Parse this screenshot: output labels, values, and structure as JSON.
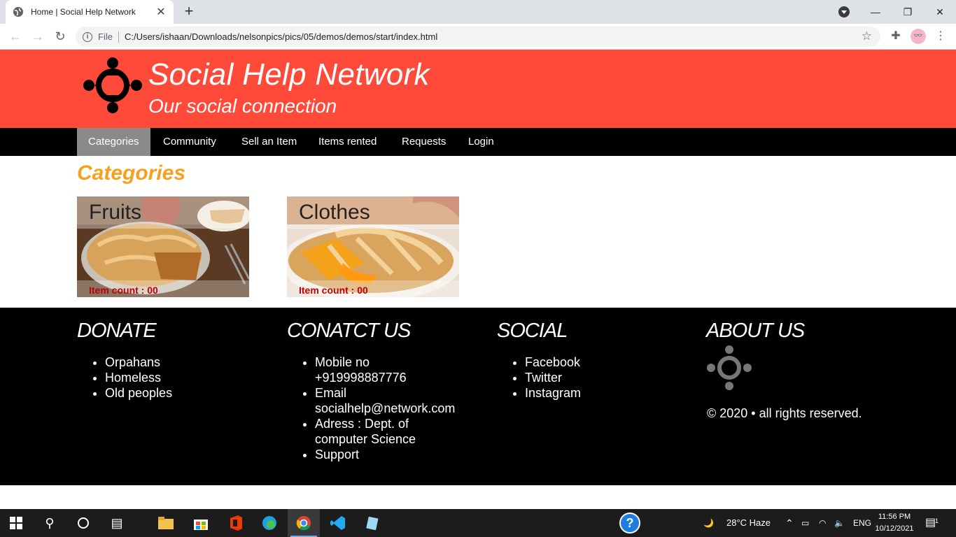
{
  "browser": {
    "tab_title": "Home | Social Help Network",
    "url_scheme_label": "File",
    "url": "C:/Users/ishaan/Downloads/nelsonpics/pics/05/demos/demos/start/index.html"
  },
  "site": {
    "title": "Social Help Network",
    "subtitle": "Our social connection"
  },
  "nav": [
    "Categories",
    "Community",
    "Sell an Item",
    "Items rented",
    "Requests",
    "Login"
  ],
  "categories": {
    "title": "Categories",
    "cards": [
      {
        "name": "Fruits",
        "count": "Item count : 00"
      },
      {
        "name": "Clothes",
        "count": "Item count : 00"
      }
    ]
  },
  "footer": {
    "donate": {
      "title": "DONATE",
      "items": [
        "Orpahans",
        "Homeless",
        "Old peoples"
      ]
    },
    "contact": {
      "title": "CONATCT US",
      "items": [
        "Mobile no +919998887776",
        "Email socialhelp@network.com",
        "Adress : Dept. of computer Science",
        "Support"
      ]
    },
    "social": {
      "title": "SOCIAL",
      "items": [
        "Facebook",
        "Twitter",
        "Instagram"
      ]
    },
    "about": {
      "title": "ABOUT US",
      "copyright": "© 2020 • all rights reserved."
    }
  },
  "taskbar": {
    "weather": "28°C  Haze",
    "language": "ENG",
    "time": "11:56 PM",
    "date": "10/12/2021",
    "notification_count": "1"
  },
  "colors": {
    "header_bg": "#ff4a3a",
    "accent": "#f6a01f",
    "count_text": "#c00000"
  }
}
